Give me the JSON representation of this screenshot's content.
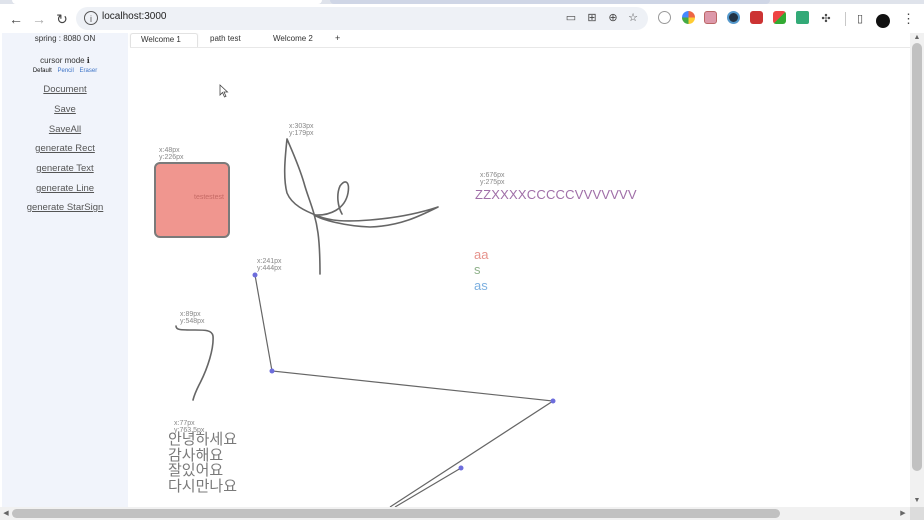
{
  "browser": {
    "url": "localhost:3000"
  },
  "colors": {
    "rect_fill": "#f0968f",
    "rect_text": "#c56a65",
    "zz_text": "#a06fa8",
    "word_aa": "#e6938c",
    "word_s": "#8fb18a",
    "word_as": "#7db0e0",
    "handle": "#6d6ddc",
    "stroke": "#666666"
  },
  "sidebar": {
    "server_status": "spring : 8080 ON",
    "cursor_mode_label": "cursor mode ℹ",
    "modes": [
      "Default",
      "Pencil",
      "Eraser"
    ],
    "links": [
      "Document",
      "Save",
      "SaveAll",
      "generate Rect",
      "generate Text",
      "generate Line",
      "generate StarSign"
    ]
  },
  "tabs": {
    "items": [
      "Welcome 1",
      "path test",
      "Welcome 2"
    ],
    "add_label": "+"
  },
  "canvas": {
    "rect": {
      "coord_x": "x:48px",
      "coord_y": "y:226px",
      "label": "testestest"
    },
    "freehand1": {
      "coord_x": "x:303px",
      "coord_y": "y:179px"
    },
    "text_block": {
      "coord_x": "x:676px",
      "coord_y": "y:275px",
      "text": "ZZXXXXCCCCCVVVVVVV"
    },
    "words": [
      "aa",
      "s",
      "as"
    ],
    "polyline": {
      "coord_x": "x:241px",
      "coord_y": "y:444px"
    },
    "freehand2": {
      "coord_x": "x:89px",
      "coord_y": "y:548px"
    },
    "korean": {
      "coord_x": "x:77px",
      "coord_y": "y:763.5px",
      "lines": [
        "안녕하세요",
        "감사해요",
        "잘있어요",
        "다시만나요"
      ]
    }
  }
}
